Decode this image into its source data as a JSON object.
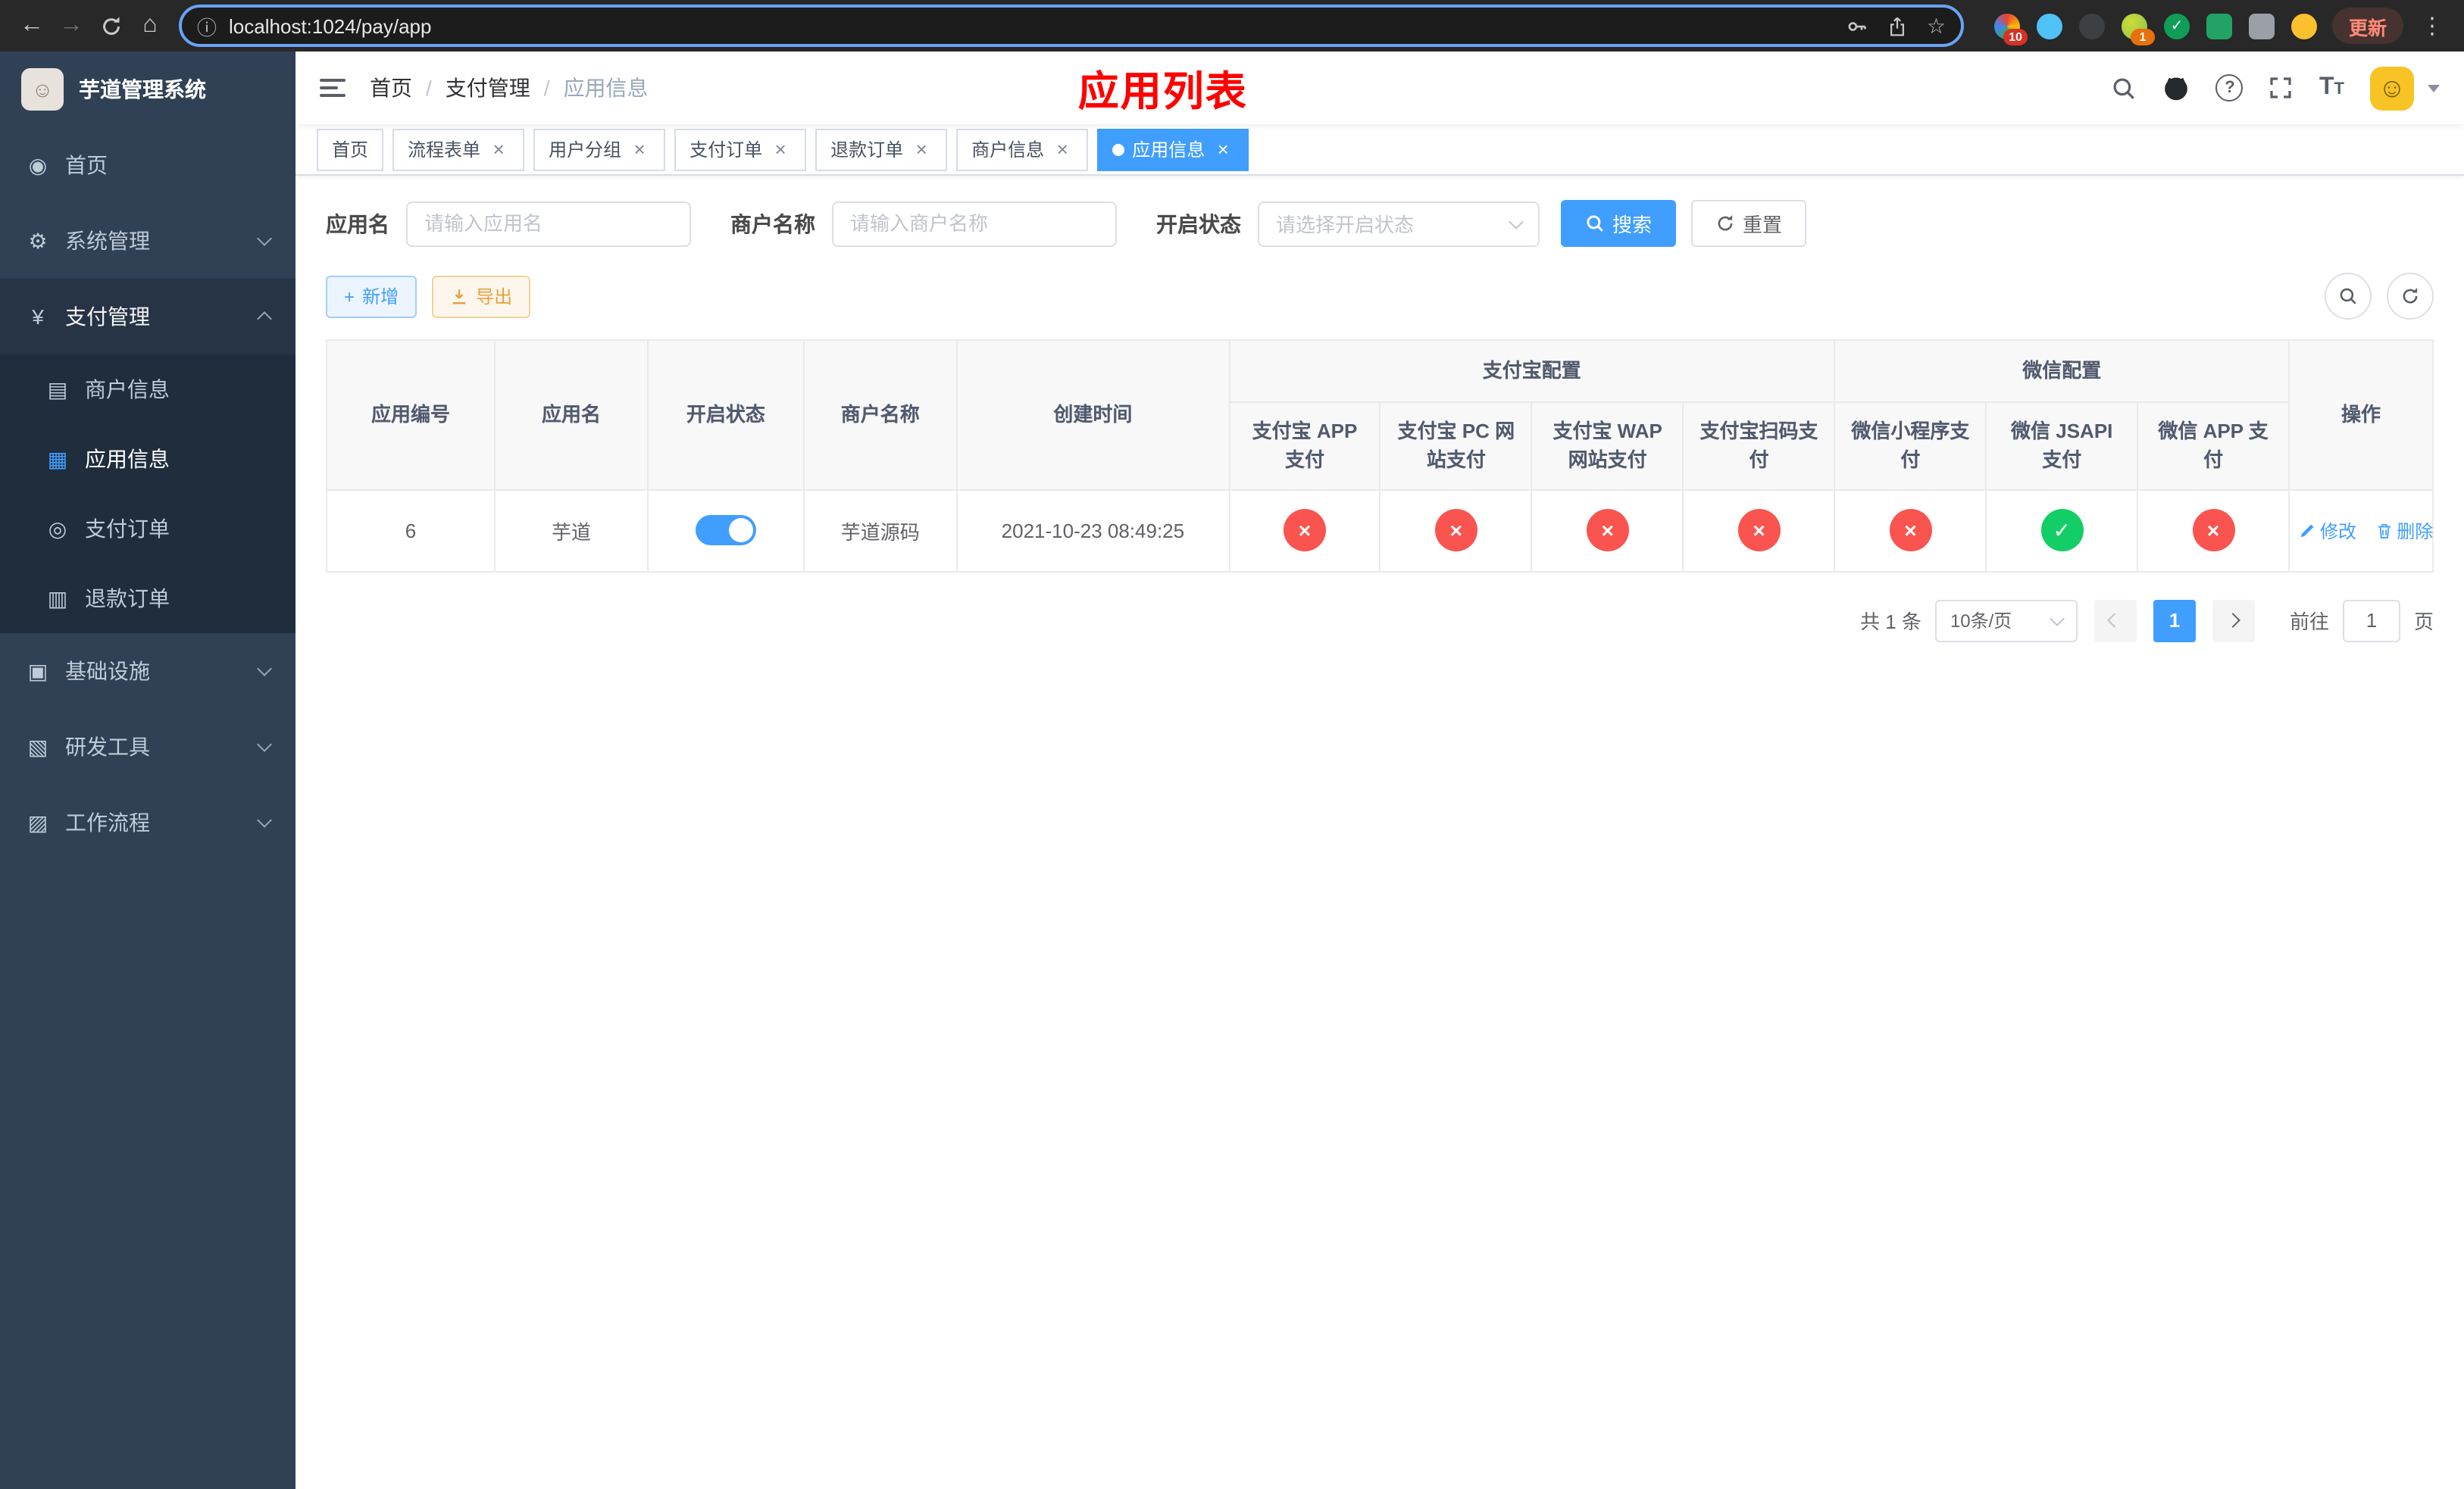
{
  "colors": {
    "accent": "#409eff",
    "danger": "#f95450",
    "success": "#13ce66",
    "title_red": "#ff0000",
    "sidebar_bg": "#304156"
  },
  "browser": {
    "url": "localhost:1024/pay/app",
    "update_label": "更新",
    "ext_badge_1": "10",
    "ext_badge_2": "1"
  },
  "sidebar": {
    "title": "芋道管理系统",
    "menu": [
      {
        "label": "首页"
      },
      {
        "label": "系统管理"
      },
      {
        "label": "支付管理"
      },
      {
        "label": "基础设施"
      },
      {
        "label": "研发工具"
      },
      {
        "label": "工作流程"
      }
    ],
    "submenu": [
      {
        "label": "商户信息"
      },
      {
        "label": "应用信息"
      },
      {
        "label": "支付订单"
      },
      {
        "label": "退款订单"
      }
    ]
  },
  "header": {
    "page_title": "应用列表"
  },
  "breadcrumb": [
    "首页",
    "支付管理",
    "应用信息"
  ],
  "tabs": [
    {
      "label": "首页"
    },
    {
      "label": "流程表单"
    },
    {
      "label": "用户分组"
    },
    {
      "label": "支付订单"
    },
    {
      "label": "退款订单"
    },
    {
      "label": "商户信息"
    },
    {
      "label": "应用信息"
    }
  ],
  "filters": {
    "app_name_label": "应用名",
    "app_name_placeholder": "请输入应用名",
    "merchant_label": "商户名称",
    "merchant_placeholder": "请输入商户名称",
    "status_label": "开启状态",
    "status_placeholder": "请选择开启状态",
    "search_label": "搜索",
    "reset_label": "重置"
  },
  "toolbar": {
    "add_label": "新增",
    "export_label": "导出"
  },
  "table": {
    "col_id": "应用编号",
    "col_name": "应用名",
    "col_status": "开启状态",
    "col_merchant": "商户名称",
    "col_created": "创建时间",
    "group_alipay": "支付宝配置",
    "group_wechat": "微信配置",
    "col_alipay_app": "支付宝 APP 支付",
    "col_alipay_pc": "支付宝 PC 网站支付",
    "col_alipay_wap": "支付宝 WAP 网站支付",
    "col_alipay_qr": "支付宝扫码支付",
    "col_wx_mini": "微信小程序支付",
    "col_wx_jsapi": "微信 JSAPI 支付",
    "col_wx_app": "微信 APP 支付",
    "col_action": "操作",
    "rows": [
      {
        "id": "6",
        "name": "芋道",
        "status": "on",
        "merchant": "芋道源码",
        "created": "2021-10-23 08:49:25",
        "configs": {
          "alipay_app": "off",
          "alipay_pc": "off",
          "alipay_wap": "off",
          "alipay_qr": "off",
          "wx_mini": "off",
          "wx_jsapi": "on",
          "wx_app": "off"
        },
        "actions": {
          "edit": "修改",
          "delete": "删除"
        }
      }
    ]
  },
  "pagination": {
    "total": "共 1 条",
    "page_size": "10条/页",
    "page": "1",
    "goto": "前往",
    "goto_value": "1",
    "unit": "页"
  }
}
